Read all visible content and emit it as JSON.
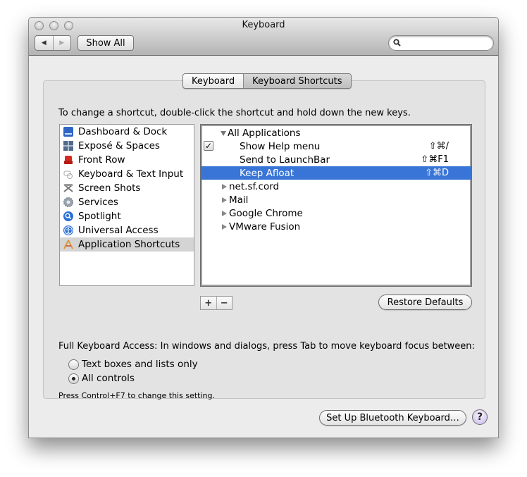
{
  "window": {
    "title": "Keyboard",
    "toolbar": {
      "back_icon": "◀",
      "forward_icon": "▶",
      "show_all_label": "Show All",
      "search_value": "",
      "search_placeholder": ""
    }
  },
  "tabs": [
    {
      "label": "Keyboard",
      "active": false
    },
    {
      "label": "Keyboard Shortcuts",
      "active": true
    }
  ],
  "instructions": "To change a shortcut, double-click the shortcut and hold down the new keys.",
  "categories": [
    {
      "label": "Dashboard & Dock",
      "icon": "dashboard-dock-icon"
    },
    {
      "label": "Exposé & Spaces",
      "icon": "expose-spaces-icon"
    },
    {
      "label": "Front Row",
      "icon": "front-row-icon"
    },
    {
      "label": "Keyboard & Text Input",
      "icon": "keyboard-text-input-icon"
    },
    {
      "label": "Screen Shots",
      "icon": "screen-shots-icon"
    },
    {
      "label": "Services",
      "icon": "services-gear-icon"
    },
    {
      "label": "Spotlight",
      "icon": "spotlight-icon"
    },
    {
      "label": "Universal Access",
      "icon": "universal-access-icon"
    },
    {
      "label": "Application Shortcuts",
      "icon": "application-shortcuts-icon",
      "selected": true
    }
  ],
  "shortcuts": {
    "group_all": {
      "label": "All Applications",
      "expanded": true
    },
    "items": [
      {
        "label": "Show Help menu",
        "keys": "⇧⌘/",
        "checked": true,
        "selected": false
      },
      {
        "label": "Send to LaunchBar",
        "keys": "⇧⌘F1",
        "checked": false,
        "selected": false
      },
      {
        "label": "Keep Afloat",
        "keys": "⇧⌘D",
        "checked": false,
        "selected": true
      }
    ],
    "apps": [
      {
        "label": "net.sf.cord",
        "expanded": false
      },
      {
        "label": "Mail",
        "expanded": false
      },
      {
        "label": "Google Chrome",
        "expanded": false
      },
      {
        "label": "VMware Fusion",
        "expanded": false
      }
    ]
  },
  "controls": {
    "add_label": "+",
    "remove_label": "−",
    "restore_defaults_label": "Restore Defaults"
  },
  "full_keyboard_access": {
    "label": "Full Keyboard Access: In windows and dialogs, press Tab to move keyboard focus between:",
    "options": [
      {
        "label": "Text boxes and lists only",
        "selected": false
      },
      {
        "label": "All controls",
        "selected": true
      }
    ],
    "hint": "Press Control+F7 to change this setting."
  },
  "footer": {
    "bluetooth_label": "Set Up Bluetooth Keyboard…",
    "help_label": "?"
  },
  "colors": {
    "selection": "#3875d7",
    "window_bg": "#ececec"
  }
}
